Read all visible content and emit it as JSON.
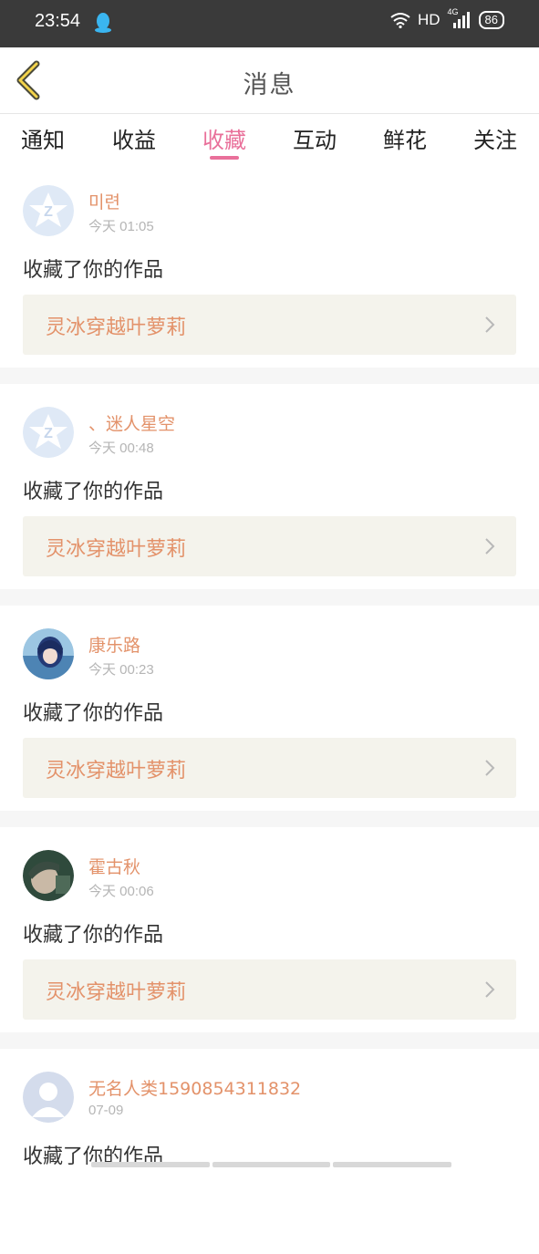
{
  "status_bar": {
    "time": "23:54",
    "network": "HD",
    "signal_label": "4G",
    "battery": "86"
  },
  "header": {
    "title": "消息"
  },
  "tabs": [
    {
      "label": "通知"
    },
    {
      "label": "收益"
    },
    {
      "label": "收藏",
      "active": true
    },
    {
      "label": "互动"
    },
    {
      "label": "鲜花"
    },
    {
      "label": "关注"
    }
  ],
  "items": [
    {
      "user": "미련",
      "time": "今天 01:05",
      "action": "收藏了你的作品",
      "work": "灵冰穿越叶萝莉",
      "avatar": "default-star-icon"
    },
    {
      "user": "、迷人星空",
      "time": "今天 00:48",
      "action": "收藏了你的作品",
      "work": "灵冰穿越叶萝莉",
      "avatar": "default-star-icon"
    },
    {
      "user": "康乐路",
      "time": "今天 00:23",
      "action": "收藏了你的作品",
      "work": "灵冰穿越叶萝莉",
      "avatar": "anime-girl-photo"
    },
    {
      "user": "霍古秋",
      "time": "今天 00:06",
      "action": "收藏了你的作品",
      "work": "灵冰穿越叶萝莉",
      "avatar": "boy-photo"
    },
    {
      "user": "无名人类1590854311832",
      "time": "07-09",
      "action": "收藏了你的作品",
      "work": "",
      "avatar": "default-person-icon"
    }
  ],
  "colors": {
    "accent": "#e9709a",
    "username": "#e3926a",
    "work_bg": "#f4f3ec",
    "statusbar_bg": "#3a3a3a"
  }
}
